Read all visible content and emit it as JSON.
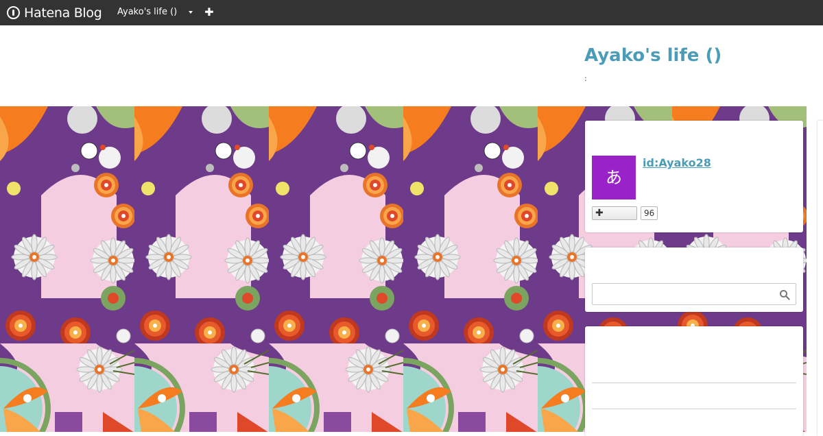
{
  "topbar": {
    "brand": "Hatena Blog",
    "blog_menu_label": "Ayako's life ()"
  },
  "header": {
    "title": "Ayako's life ()",
    "description": ":"
  },
  "profile": {
    "avatar_char": "あ",
    "user_id": "id:Ayako28",
    "follow_count": "96"
  },
  "search": {
    "value": "",
    "placeholder": ""
  },
  "colors": {
    "topbar": "#333333",
    "title": "#4b9cb8",
    "avatar": "#9a22c9"
  },
  "icons": [
    "hatena-logo-icon",
    "caret-down-icon",
    "plus-icon",
    "search-icon"
  ]
}
